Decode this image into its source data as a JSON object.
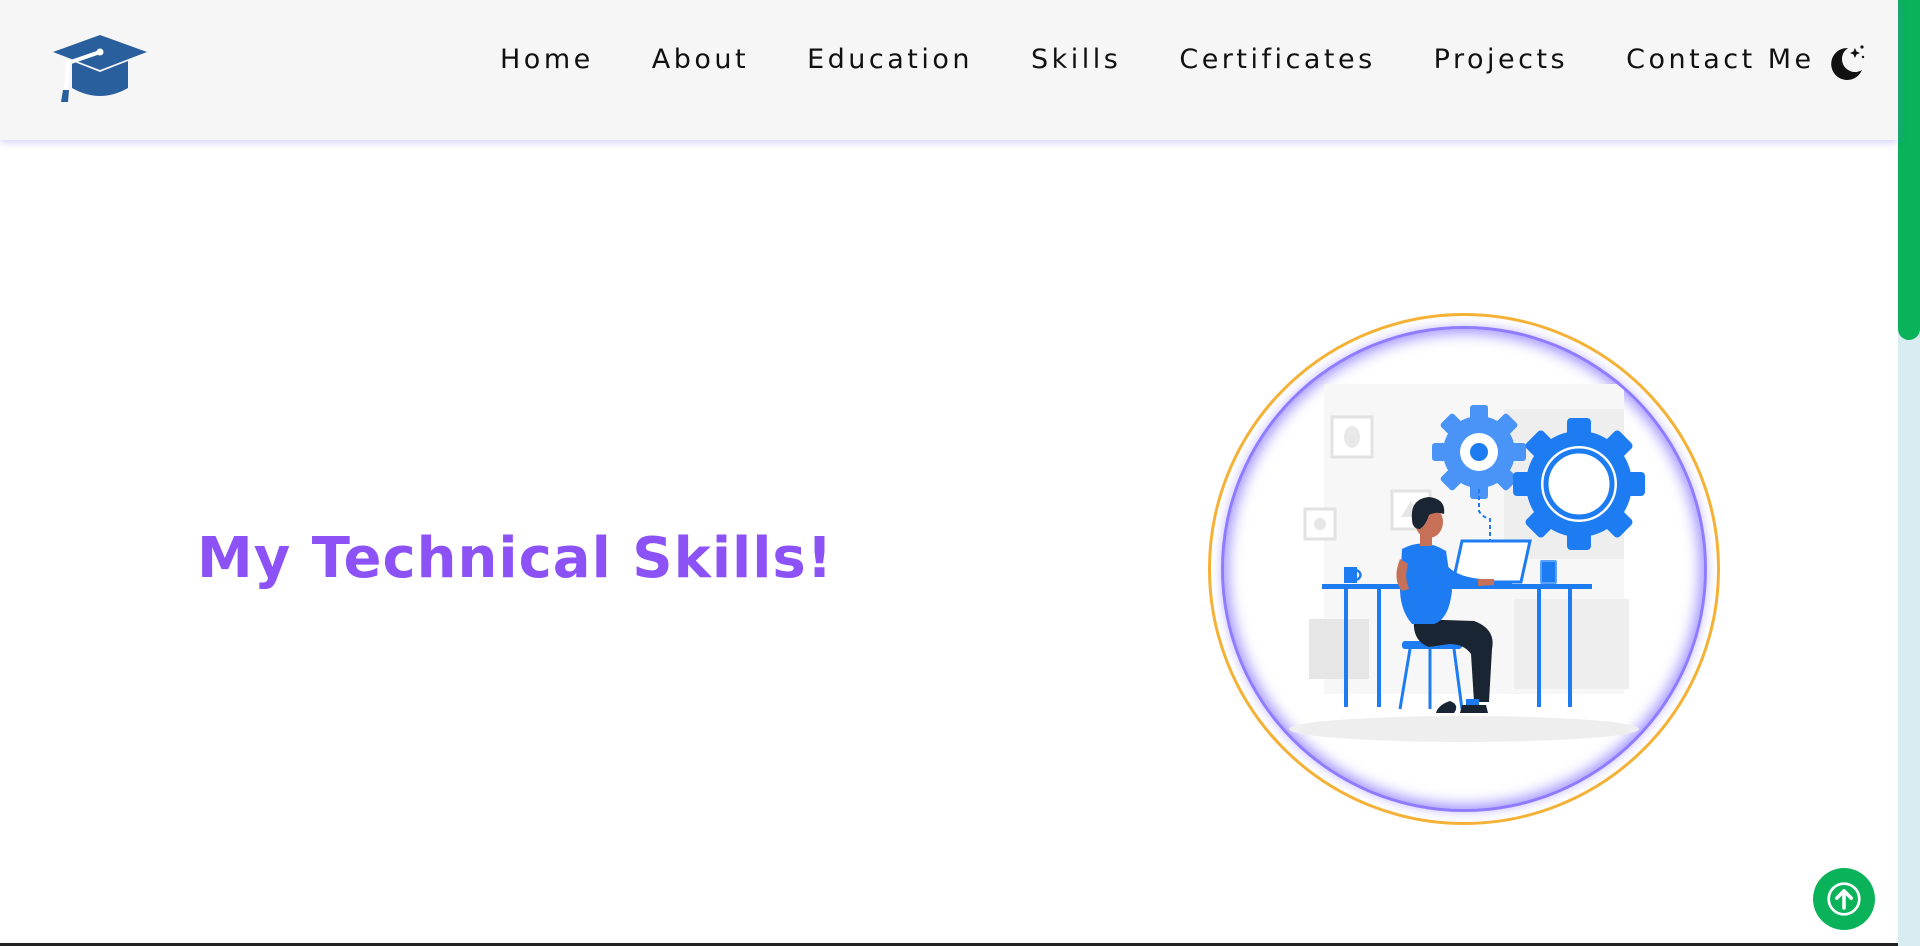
{
  "header": {
    "logo_icon": "graduation-cap-icon",
    "nav": [
      {
        "label": "Home"
      },
      {
        "label": "About"
      },
      {
        "label": "Education"
      },
      {
        "label": "Skills"
      },
      {
        "label": "Certificates"
      },
      {
        "label": "Projects"
      },
      {
        "label": "Contact Me"
      }
    ],
    "theme_icon": "moon-stars-icon"
  },
  "main": {
    "title": "My Technical Skills!",
    "illustration_icon": "developer-at-desk-with-gears-illustration"
  },
  "back_to_top_icon": "arrow-up-icon",
  "colors": {
    "accent_purple": "#8c52f5",
    "logo_blue": "#2a5f9e",
    "scroll_green": "#0ab25a",
    "ring_orange": "#f6b236",
    "illustration_blue": "#1e7cf2"
  }
}
